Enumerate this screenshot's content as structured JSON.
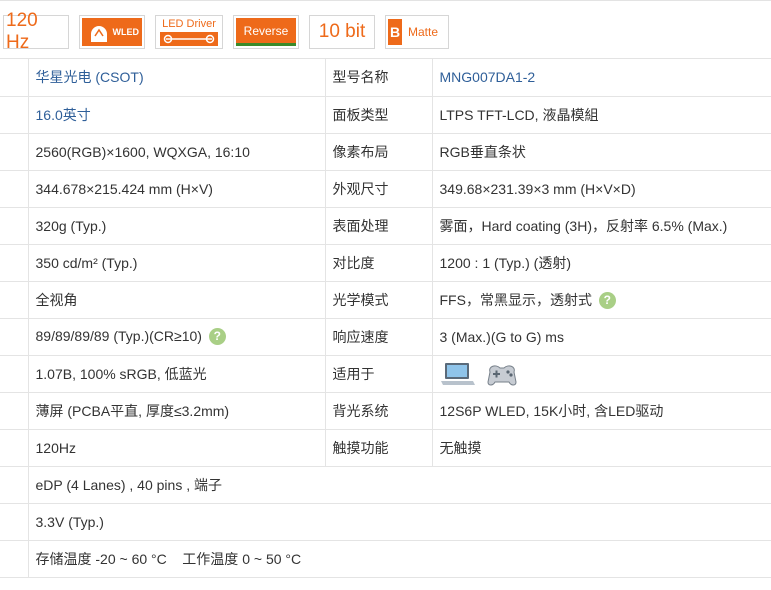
{
  "badges": {
    "refresh": "120 Hz",
    "wled": "WLED",
    "led_driver": "LED Driver",
    "reverse": "Reverse",
    "bit_depth": "10 bit",
    "matte_letter": "B",
    "matte": "Matte"
  },
  "colors": {
    "accent": "#ee6a1a",
    "link": "#2f5f99",
    "help": "#a9cf86",
    "reverse_underline": "#3a8a2a"
  },
  "rows": [
    {
      "v1": "华星光电 (CSOT)",
      "k2": "型号名称",
      "v2": "MNG007DA1-2"
    },
    {
      "v1": "16.0英寸",
      "k2": "面板类型",
      "v2": "LTPS TFT-LCD, 液晶模組"
    },
    {
      "v1": "2560(RGB)×1600, WQXGA, 16:10",
      "k2": "像素布局",
      "v2": "RGB垂直条状"
    },
    {
      "v1": "344.678×215.424 mm (H×V)",
      "k2": "外观尺寸",
      "v2": "349.68×231.39×3 mm (H×V×D)"
    },
    {
      "v1": "320g (Typ.)",
      "k2": "表面处理",
      "v2": "雾面，Hard coating (3H)，反射率 6.5% (Max.)"
    },
    {
      "v1": "350 cd/m² (Typ.)",
      "k2": "对比度",
      "v2": "1200 : 1 (Typ.) (透射)"
    },
    {
      "v1": "全视角",
      "k2": "光学模式",
      "v2": "FFS，常黑显示，透射式"
    },
    {
      "v1": "89/89/89/89 (Typ.)(CR≥10)",
      "k2": "响应速度",
      "v2": "3 (Max.)(G to G) ms"
    },
    {
      "v1": "1.07B, 100% sRGB, 低蓝光",
      "k2": "适用于",
      "v2": ""
    },
    {
      "v1": "薄屏 (PCBA平直, 厚度≤3.2mm)",
      "k2": "背光系统",
      "v2": "12S6P WLED, 15K小时, 含LED驱动"
    },
    {
      "v1": "120Hz",
      "k2": "触摸功能",
      "v2": "无触摸"
    },
    {
      "v1": "eDP (4 Lanes) , 40 pins , 端子",
      "k2": "",
      "v2": ""
    },
    {
      "v1": "3.3V (Typ.)",
      "k2": "",
      "v2": ""
    },
    {
      "v1": "存储温度 -20 ~ 60 °C    工作温度 0 ~ 50 °C",
      "k2": "",
      "v2": ""
    }
  ],
  "help_glyph": "?",
  "application_icons": [
    "laptop-icon",
    "gamepad-icon"
  ]
}
